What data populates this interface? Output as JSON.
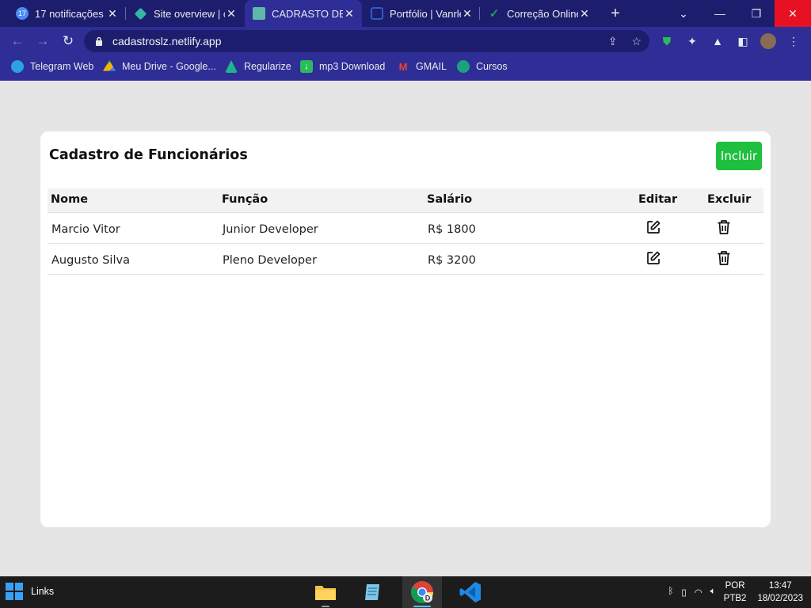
{
  "browser": {
    "tabs": [
      {
        "label": "17 notificações",
        "badge": "17",
        "color": "#4c8bf5"
      },
      {
        "label": "Site overview | c",
        "color": "#36b5a7"
      },
      {
        "label": "CADRASTO DE F",
        "color": "#5fb7a9",
        "active": true
      },
      {
        "label": "Portfólio | Vanrle",
        "color": "#2c5fc2"
      },
      {
        "label": "Correção Online",
        "color": "#1ea34e"
      }
    ],
    "url": "cadastroslz.netlify.app",
    "bookmarks": [
      {
        "label": "Telegram Web",
        "color": "#2aa3e0"
      },
      {
        "label": "Meu Drive - Google...",
        "color": "#f4b400"
      },
      {
        "label": "Regularize",
        "color": "#1fb58c"
      },
      {
        "label": "mp3 Download",
        "color": "#2bbb5a"
      },
      {
        "label": "GMAIL",
        "color": "#ea4335"
      },
      {
        "label": "Cursos",
        "color": "#1aa37a"
      }
    ]
  },
  "page": {
    "title": "Cadastro de Funcionários",
    "add_button": "Incluir",
    "columns": {
      "name": "Nome",
      "role": "Função",
      "salary": "Salário",
      "edit": "Editar",
      "delete": "Excluir"
    },
    "rows": [
      {
        "name": "Marcio Vitor",
        "role": "Junior Developer",
        "salary": "R$ 1800"
      },
      {
        "name": "Augusto Silva",
        "role": "Pleno Developer",
        "salary": "R$ 3200"
      }
    ],
    "colors": {
      "accent": "#1fbf3f",
      "background": "#e5e5e5"
    }
  },
  "taskbar": {
    "links_label": "Links",
    "lang_top": "POR",
    "lang_bottom": "PTB2",
    "time": "13:47",
    "date": "18/02/2023"
  }
}
